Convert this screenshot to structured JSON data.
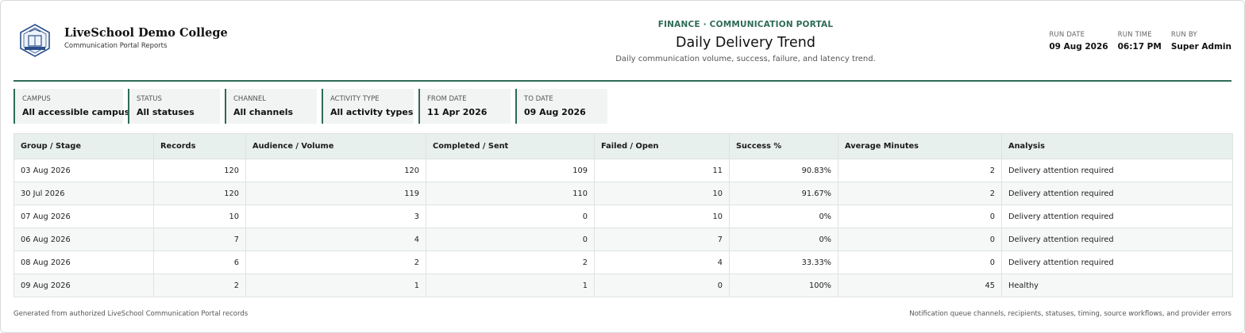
{
  "header": {
    "college_name": "LiveSchool Demo College",
    "college_subtitle": "Communication Portal Reports",
    "portal": "FINANCE · COMMUNICATION PORTAL",
    "title": "Daily Delivery Trend",
    "subtitle": "Daily communication volume, success, failure, and latency trend.",
    "logo_icon": "college-crest-icon",
    "accent_color": "#2e6b55"
  },
  "meta": [
    {
      "label": "RUN DATE",
      "value": "09 Aug 2026"
    },
    {
      "label": "RUN TIME",
      "value": "06:17 PM"
    },
    {
      "label": "RUN BY",
      "value": "Super Admin"
    }
  ],
  "filters": [
    {
      "label": "CAMPUS",
      "value": "All accessible campuses"
    },
    {
      "label": "STATUS",
      "value": "All statuses"
    },
    {
      "label": "CHANNEL",
      "value": "All channels"
    },
    {
      "label": "ACTIVITY TYPE",
      "value": "All activity types"
    },
    {
      "label": "FROM DATE",
      "value": "11 Apr 2026"
    },
    {
      "label": "TO DATE",
      "value": "09 Aug 2026"
    }
  ],
  "table": {
    "columns": [
      "Group / Stage",
      "Records",
      "Audience / Volume",
      "Completed / Sent",
      "Failed / Open",
      "Success %",
      "Average Minutes",
      "Analysis"
    ],
    "rows": [
      [
        "03 Aug 2026",
        "120",
        "120",
        "109",
        "11",
        "90.83%",
        "2",
        "Delivery attention required"
      ],
      [
        "30 Jul 2026",
        "120",
        "119",
        "110",
        "10",
        "91.67%",
        "2",
        "Delivery attention required"
      ],
      [
        "07 Aug 2026",
        "10",
        "3",
        "0",
        "10",
        "0%",
        "0",
        "Delivery attention required"
      ],
      [
        "06 Aug 2026",
        "7",
        "4",
        "0",
        "7",
        "0%",
        "0",
        "Delivery attention required"
      ],
      [
        "08 Aug 2026",
        "6",
        "2",
        "2",
        "4",
        "33.33%",
        "0",
        "Delivery attention required"
      ],
      [
        "09 Aug 2026",
        "2",
        "1",
        "1",
        "0",
        "100%",
        "45",
        "Healthy"
      ]
    ]
  },
  "footer": {
    "left": "Generated from authorized LiveSchool Communication Portal records",
    "right": "Notification queue channels, recipients, statuses, timing, source workflows, and provider errors"
  }
}
